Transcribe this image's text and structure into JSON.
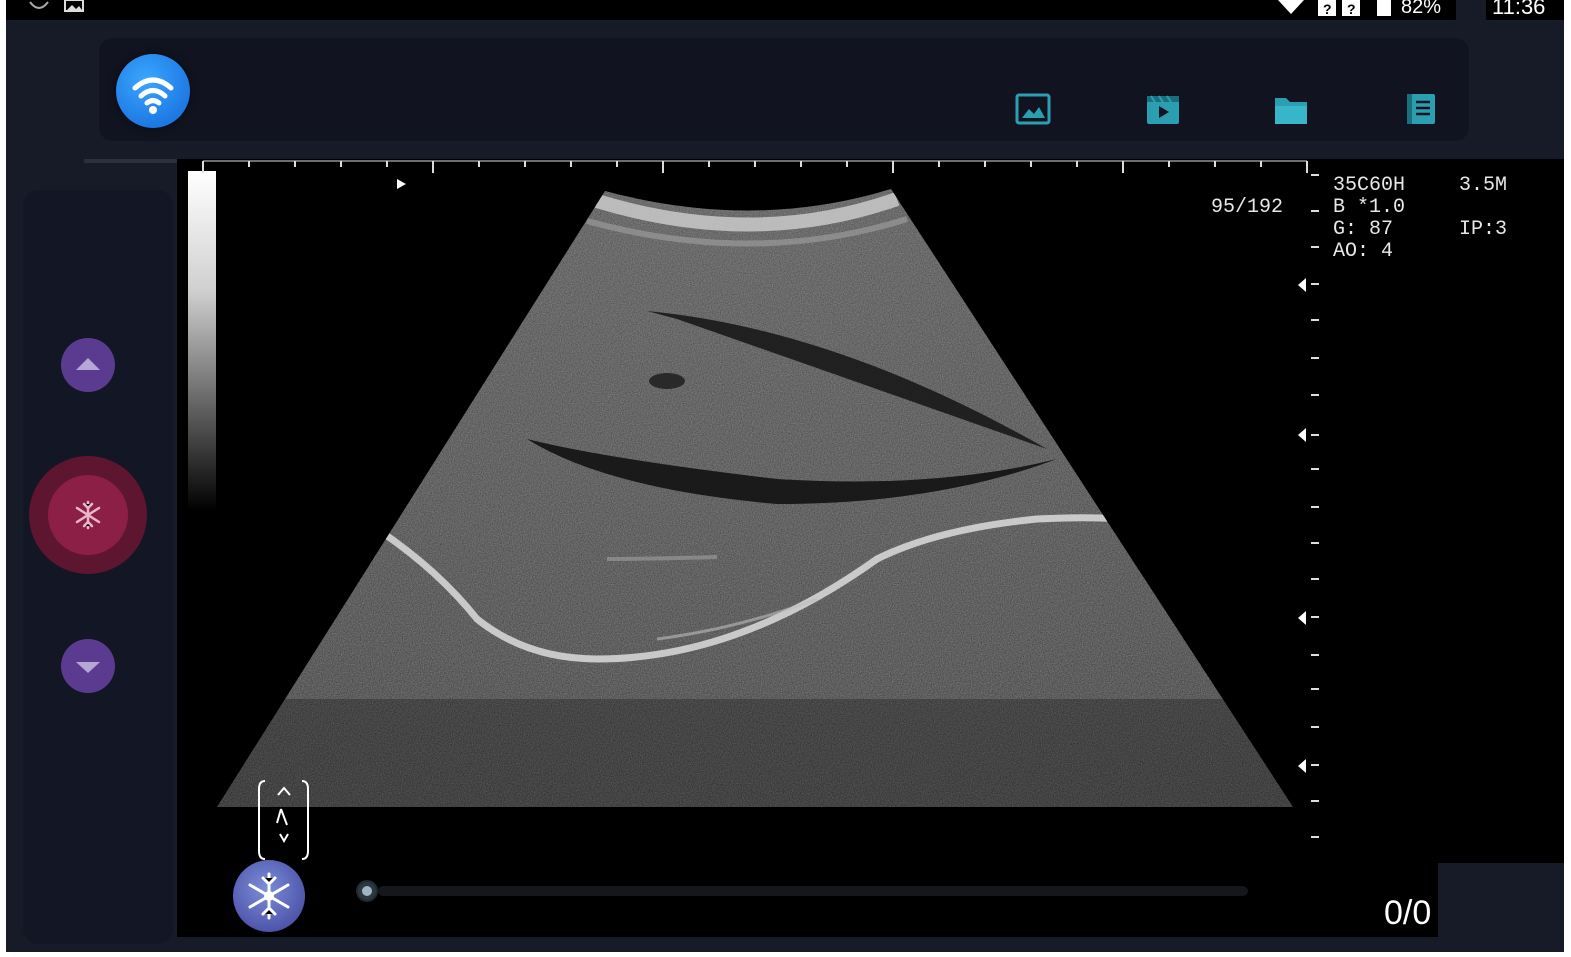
{
  "status_bar": {
    "battery_text": "82%",
    "time": "11:36",
    "icons": [
      "sync-icon",
      "image-notification-icon",
      "wifi-signal-icon",
      "no-sim-icon",
      "no-sim-icon",
      "battery-icon"
    ]
  },
  "toolbar": {
    "wifi_button_icon": "wifi-icon",
    "actions": [
      {
        "name": "image-gallery-button",
        "icon": "image-icon"
      },
      {
        "name": "video-clips-button",
        "icon": "video-clapper-icon"
      },
      {
        "name": "folder-button",
        "icon": "folder-icon"
      },
      {
        "name": "report-button",
        "icon": "document-list-icon"
      }
    ],
    "accent_color": "#2a9fb2"
  },
  "side_panel": {
    "up_icon": "triangle-up-icon",
    "freeze_icon": "snowflake-icon",
    "down_icon": "triangle-down-icon",
    "up_down_color": "#5b3b8f",
    "freeze_color": "#7a1a3e"
  },
  "scan_info": {
    "frame_position": "95/192",
    "probe": "35C60H",
    "frequency": "3.5M",
    "mode": "B *1.0",
    "gain": "G: 87",
    "image_preset": "IP:3",
    "acoustic_output": "AO: 4"
  },
  "cine": {
    "freeze_icon": "snowflake-icon",
    "frame_counter": "0/0",
    "progress": 0
  },
  "grayscale_bar_icon": "grayscale-bar",
  "probe_orientation_icon": "probe-orientation-icon"
}
